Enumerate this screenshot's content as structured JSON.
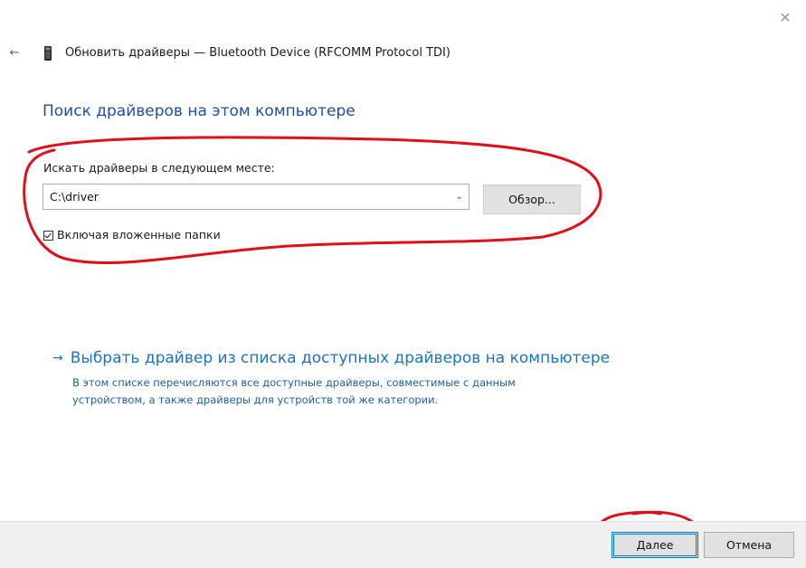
{
  "window": {
    "title": "Обновить драйверы — Bluetooth Device (RFCOMM Protocol TDI)",
    "close_icon": "close-icon",
    "back_icon": "back-arrow-icon",
    "device_icon": "bluetooth-device-icon"
  },
  "main": {
    "heading": "Поиск драйверов на этом компьютере",
    "search_label": "Искать драйверы в следующем месте:",
    "path_value": "C:\\driver",
    "browse_label": "Обзор...",
    "include_subfolders_label": "Включая вложенные папки",
    "include_subfolders_checked": true
  },
  "alternative": {
    "arrow": "→",
    "link_label": "Выбрать драйвер из списка доступных драйверов на компьютере",
    "description": "В этом списке перечисляются все доступные драйверы, совместимые с данным устройством, а также драйверы для устройств той же категории."
  },
  "footer": {
    "next_label": "Далее",
    "cancel_label": "Отмена"
  },
  "colors": {
    "heading": "#1f4fa3",
    "link": "#1a73c8",
    "annotation": "#e0101a",
    "footer_bg": "#f0f0f0"
  }
}
